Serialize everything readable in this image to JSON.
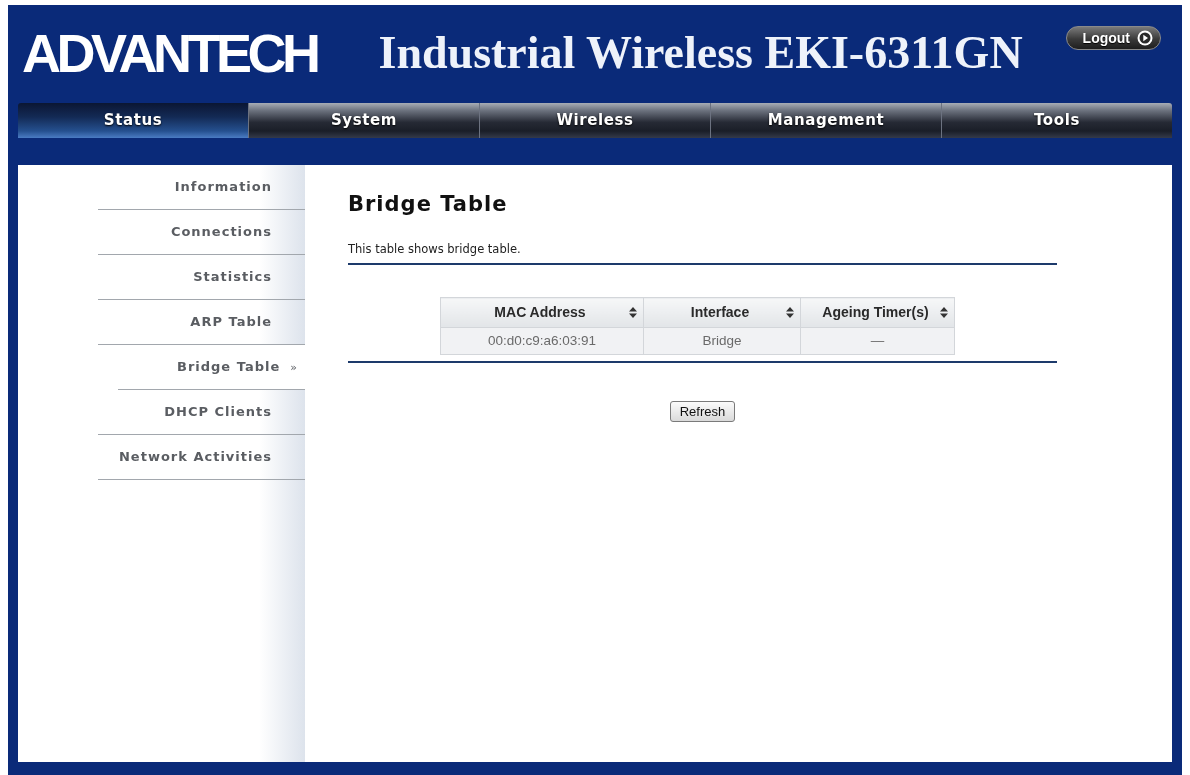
{
  "header": {
    "logo": "ADVANTECH",
    "title": "Industrial Wireless EKI-6311GN",
    "logout_button": "Logout"
  },
  "tabs": [
    {
      "label": "Status",
      "selected": true
    },
    {
      "label": "System",
      "selected": false
    },
    {
      "label": "Wireless",
      "selected": false
    },
    {
      "label": "Management",
      "selected": false
    },
    {
      "label": "Tools",
      "selected": false
    }
  ],
  "sidebar": {
    "items": [
      {
        "label": "Information",
        "selected": false
      },
      {
        "label": "Connections",
        "selected": false
      },
      {
        "label": "Statistics",
        "selected": false
      },
      {
        "label": "ARP Table",
        "selected": false
      },
      {
        "label": "Bridge Table",
        "selected": true,
        "marker": "»"
      },
      {
        "label": "DHCP Clients",
        "selected": false
      },
      {
        "label": "Network Activities",
        "selected": false
      }
    ]
  },
  "content": {
    "title": "Bridge Table",
    "description": "This table shows bridge table.",
    "table": {
      "columns": [
        {
          "label": "MAC Address",
          "sortable": true
        },
        {
          "label": "Interface",
          "sortable": true
        },
        {
          "label": "Ageing Timer(s)",
          "sortable": true
        }
      ],
      "rows": [
        [
          "00:d0:c9:a6:03:91",
          "Bridge",
          "—"
        ]
      ]
    },
    "refresh_button": "Refresh"
  }
}
